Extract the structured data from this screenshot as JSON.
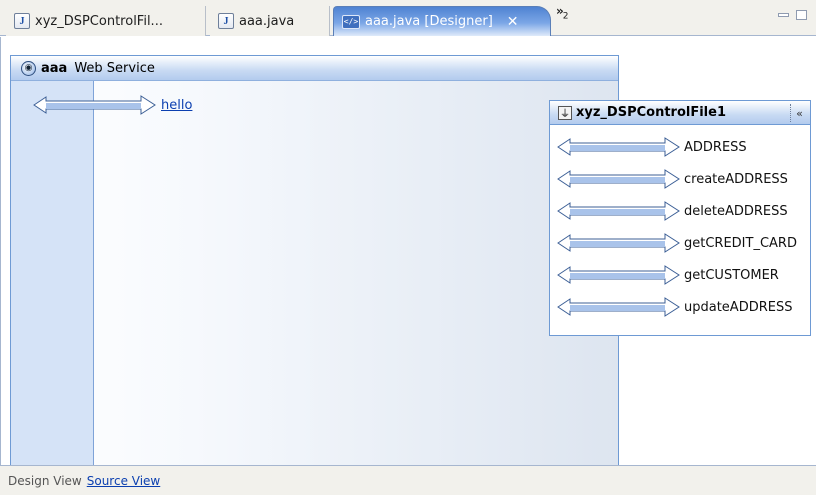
{
  "tabs": [
    {
      "label": "xyz_DSPControlFil...",
      "icon": "java-file-icon"
    },
    {
      "label": "aaa.java",
      "icon": "java-file-icon"
    },
    {
      "label": "aaa.java [Designer]",
      "icon": "designer-icon",
      "active": true
    }
  ],
  "tab_overflow": {
    "symbol": "»",
    "count": "2"
  },
  "service": {
    "name": "aaa",
    "kind": "Web Service",
    "operations": [
      "hello"
    ]
  },
  "control": {
    "name": "xyz_DSPControlFile1",
    "collapse_glyph": "«",
    "operations": [
      "ADDRESS",
      "createADDRESS",
      "deleteADDRESS",
      "getCREDIT_CARD",
      "getCUSTOMER",
      "updateADDRESS"
    ]
  },
  "footer": {
    "design_view": "Design View",
    "source_view": "Source View"
  },
  "colors": {
    "accent": "#4f83d2",
    "link": "#0b3fb0",
    "panel_border": "#6e9ad4"
  }
}
